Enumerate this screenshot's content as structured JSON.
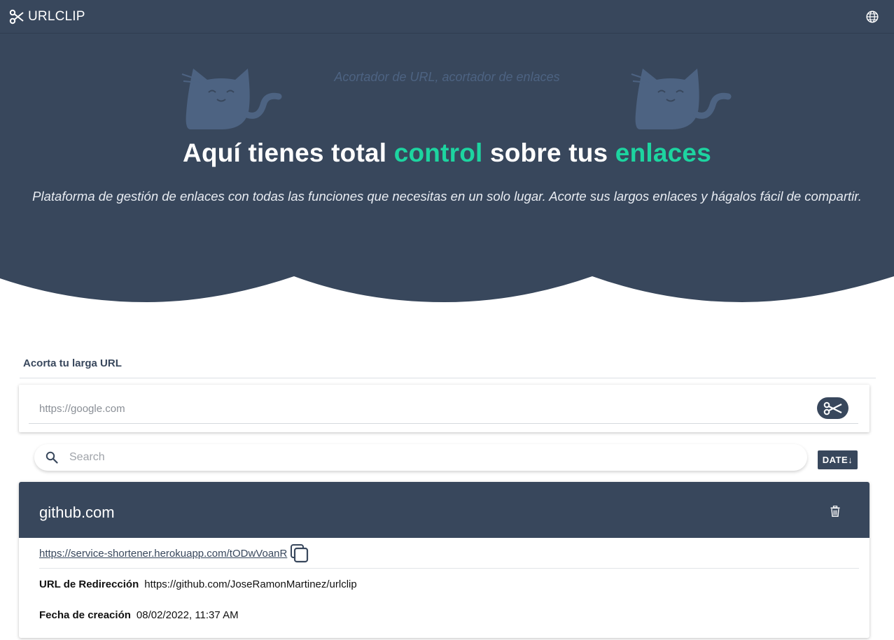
{
  "topbar": {
    "brand": "URLCLIP",
    "logo_icon": "scissors-icon",
    "language_icon": "globe-icon"
  },
  "hero": {
    "tagline": "Acortador de URL, acortador de enlaces",
    "headline_parts": [
      "Aquí tienes total ",
      "control",
      " sobre tus ",
      "enlaces"
    ],
    "subtitle": "Plataforma de gestión de enlaces con todas las funciones que necesitas en un solo lugar. Acorte sus largos enlaces y hágalos fácil de compartir.",
    "illustration_icon": "cat-icon"
  },
  "shortener": {
    "section_title": "Acorta tu larga URL",
    "placeholder": "https://google.com",
    "submit_icon": "scissors-icon"
  },
  "search": {
    "placeholder": "Search",
    "sort_label": "DATE↓"
  },
  "links": [
    {
      "domain": "github.com",
      "short_url": "https://service-shortener.herokuapp.com/tODwVoanR",
      "redirect_label": "URL de Redirección",
      "redirect_url": "https://github.com/JoseRamonMartinez/urlclip",
      "created_label": "Fecha de creación",
      "created_at": "08/02/2022, 11:37 AM"
    }
  ],
  "colors": {
    "primary": "#38475c",
    "accent": "#1dd4a0",
    "background": "#ffffff"
  }
}
